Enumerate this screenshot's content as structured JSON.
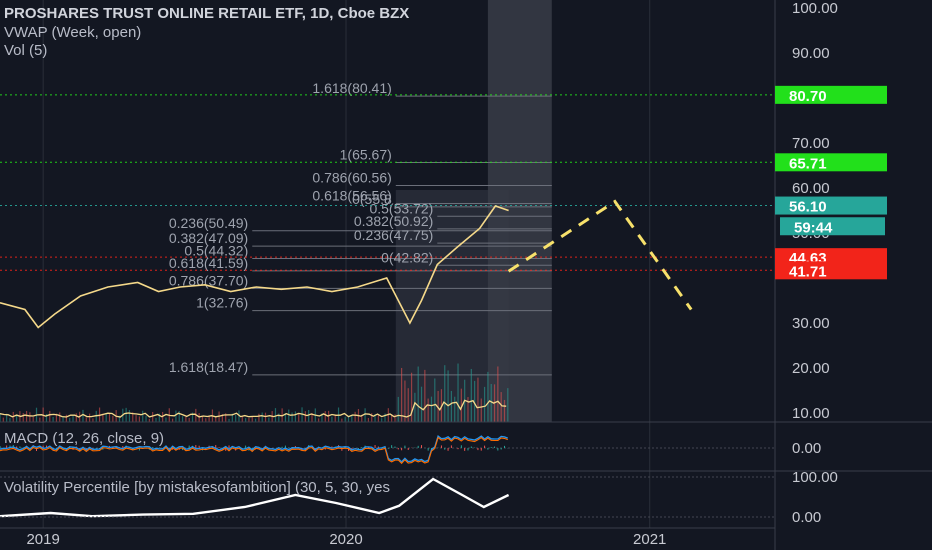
{
  "legend": {
    "title": "PROSHARES TRUST ONLINE RETAIL ETF, 1D, Cboe BZX",
    "vwap": "VWAP (Week, open)",
    "vol": "Vol (5)"
  },
  "macd_title": "MACD (12, 26, close, 9)",
  "volatility_title": "Volatility Percentile [by mistakesofambition] (30, 5, 30, yes",
  "colors": {
    "background": "#131722",
    "price": "#f5d98a",
    "green_badge": "#22e01b",
    "red_badge": "#f2241a",
    "teal_badge": "#26a69a",
    "projection": "#f7e16b"
  },
  "chart_data": [
    {
      "type": "line",
      "pane": "price",
      "ylim": [
        0,
        100
      ],
      "yticks": [
        "100.00",
        "90.00",
        "70.00",
        "60.00",
        "50.00",
        "30.00",
        "20.00",
        "10.00"
      ],
      "ytick_values": [
        100,
        90,
        70,
        60,
        50,
        30,
        20,
        10
      ],
      "xticks": [
        "2019",
        "2020",
        "2021"
      ],
      "x_range": [
        "2018-11-10",
        "2021-06-01"
      ],
      "series": [
        {
          "x": [
            "2018-11-10",
            "2018-12-10",
            "2018-12-26",
            "2019-01-15",
            "2019-02-15",
            "2019-03-20",
            "2019-04-25",
            "2019-05-20",
            "2019-06-15",
            "2019-07-15",
            "2019-08-15",
            "2019-09-15",
            "2019-10-15",
            "2019-11-15",
            "2019-12-15",
            "2020-01-15",
            "2020-02-19",
            "2020-03-18",
            "2020-04-01",
            "2020-04-20",
            "2020-05-15",
            "2020-06-10",
            "2020-06-29",
            "2020-07-15"
          ],
          "values": [
            34.5,
            33,
            29,
            32,
            36,
            38,
            39,
            37,
            38,
            38.5,
            37,
            38,
            37.5,
            38,
            37,
            38,
            40,
            30,
            35,
            43,
            47,
            51,
            56,
            55
          ]
        }
      ],
      "projection": {
        "x": [
          "2020-07-15",
          "2020-11-20",
          "2021-02-20"
        ],
        "values": [
          41.5,
          57,
          33
        ]
      },
      "fib_levels": [
        {
          "label": "1.618(80.41)",
          "value": 80.41
        },
        {
          "label": "1(65.67)",
          "value": 65.67
        },
        {
          "label": "0.786(60.56)",
          "value": 60.56
        },
        {
          "label": "0.618(56.56)",
          "value": 56.56
        },
        {
          "label": "0(55.8",
          "value": 55.8
        },
        {
          "label": "0.5(53.72)",
          "value": 53.72
        },
        {
          "label": "0.382(50.92)",
          "value": 50.92
        },
        {
          "label": "0.236(50.49)",
          "value": 50.49
        },
        {
          "label": "0.382(47.09)",
          "value": 47.09
        },
        {
          "label": "0.236(47.75)",
          "value": 47.75
        },
        {
          "label": "0.5(44.32)",
          "value": 44.32
        },
        {
          "label": "0(42.82)",
          "value": 42.82
        },
        {
          "label": "0.618(41.59)",
          "value": 41.59
        },
        {
          "label": "0.786(37.70)",
          "value": 37.7
        },
        {
          "label": "1(32.76)",
          "value": 32.76
        },
        {
          "label": "1.618(18.47)",
          "value": 18.47
        }
      ],
      "price_labels": [
        {
          "text": "80.70",
          "value": 80.7,
          "color": "#22e01b"
        },
        {
          "text": "65.71",
          "value": 65.71,
          "color": "#22e01b"
        },
        {
          "text": "56.10",
          "value": 56.1,
          "color": "#26a69a"
        },
        {
          "text": "59:44",
          "value": 51.5,
          "color": "#26a69a"
        },
        {
          "text": "44.63",
          "value": 44.63,
          "color": "#f2241a"
        },
        {
          "text": "41.71",
          "value": 41.71,
          "color": "#f2241a"
        }
      ]
    },
    {
      "type": "line",
      "pane": "macd",
      "yticks": [
        "0.00"
      ],
      "series": [
        {
          "name": "MACD"
        },
        {
          "name": "Signal"
        }
      ]
    },
    {
      "type": "line",
      "pane": "volatility",
      "ylim": [
        0,
        100
      ],
      "yticks": [
        "100.00",
        "0.00"
      ],
      "ytick_values": [
        100,
        0
      ],
      "series": [
        {
          "x": [
            "2018-11-10",
            "2019-01-10",
            "2019-03-01",
            "2019-05-01",
            "2019-07-01",
            "2019-09-01",
            "2019-11-01",
            "2019-12-20",
            "2020-02-10",
            "2020-03-05",
            "2020-04-15",
            "2020-05-20",
            "2020-06-15",
            "2020-07-15"
          ],
          "values": [
            2,
            10,
            2,
            6,
            8,
            25,
            55,
            35,
            10,
            28,
            95,
            55,
            25,
            55
          ]
        }
      ]
    }
  ]
}
